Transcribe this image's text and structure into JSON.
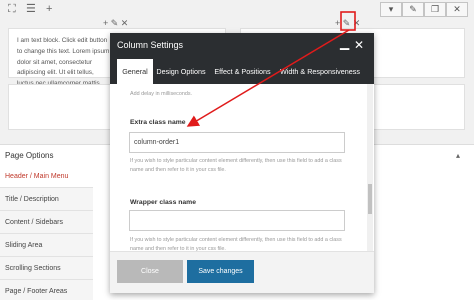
{
  "background": {
    "column_a_text": "I am text block. Click edit button to change this text. Lorem ipsum dolor sit amet, consectetur adipiscing elit. Ut elit tellus, luctus nec ullamcorper mattis, pulvinar dapibus leo.",
    "toolbar_glyphs": {
      "expand": "⛶",
      "menu": "☰",
      "add": "+"
    },
    "column_controls": "+ ✎ ✕",
    "right_buttons": {
      "dropdown": "▾",
      "edit": "✎",
      "copy": "❐",
      "close": "✕"
    }
  },
  "page_options": {
    "title": "Page Options",
    "arrow": "▴",
    "menu": [
      {
        "label": "Header / Main Menu",
        "active": true
      },
      {
        "label": "Title / Description",
        "active": false
      },
      {
        "label": "Content / Sidebars",
        "active": false
      },
      {
        "label": "Sliding Area",
        "active": false
      },
      {
        "label": "Scrolling Sections",
        "active": false
      },
      {
        "label": "Page / Footer Areas",
        "active": false
      }
    ]
  },
  "modal": {
    "title": "Column Settings",
    "minimize": "▁",
    "close": "✕",
    "tabs": [
      {
        "label": "General",
        "active": true
      },
      {
        "label": "Design Options",
        "active": false
      },
      {
        "label": "Effect & Positions",
        "active": false
      },
      {
        "label": "Width & Responsiveness",
        "active": false
      }
    ],
    "hint_delay": "Add delay in milliseconds.",
    "extra_class": {
      "label": "Extra class name",
      "value": "column-order1",
      "help": "If you wish to style particular content element differently, then use this field to add a class name and then refer to it in your css file."
    },
    "wrapper_class": {
      "label": "Wrapper class name",
      "value": "",
      "help": "If you wish to style particular content element differently, then use this field to add a class name and then refer to it in your css file."
    },
    "buttons": {
      "close": "Close",
      "save": "Save changes"
    }
  },
  "colors": {
    "accent_red": "#e01b1b",
    "modal_header": "#2b2e31",
    "save_button": "#1e6ea0"
  }
}
